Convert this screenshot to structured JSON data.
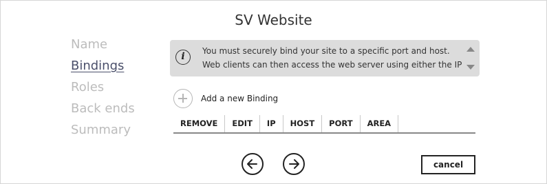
{
  "window": {
    "title": "SV Website"
  },
  "nav": {
    "items": [
      {
        "label": "Name",
        "active": false
      },
      {
        "label": "Bindings",
        "active": true
      },
      {
        "label": "Roles",
        "active": false
      },
      {
        "label": "Back ends",
        "active": false
      },
      {
        "label": "Summary",
        "active": false
      }
    ]
  },
  "info": {
    "icon": "info-icon",
    "text": "You must securely bind your site to a specific port and host. Web clients can then access the web server using either the IP"
  },
  "bindings": {
    "add_label": "Add a new Binding",
    "columns": [
      "REMOVE",
      "EDIT",
      "IP",
      "HOST",
      "PORT",
      "AREA"
    ],
    "rows": []
  },
  "footer": {
    "back_icon": "arrow-left-icon",
    "next_icon": "arrow-right-icon",
    "cancel_label": "cancel"
  }
}
